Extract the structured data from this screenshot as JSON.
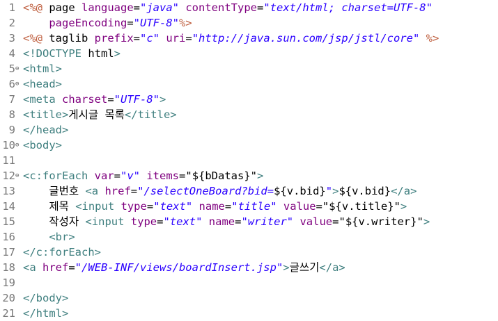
{
  "colors": {
    "directive": "#bf5f3f",
    "attribute": "#7f007f",
    "value": "#2a00ff",
    "tag": "#3f7f7f",
    "text": "#000000",
    "line_number": "#787878"
  },
  "fold_icon": "collapse-minus-icon",
  "lines": [
    {
      "n": "1",
      "fold": false,
      "tokens": [
        [
          "directive",
          "<%@ "
        ],
        [
          "text",
          "page "
        ],
        [
          "attr",
          "language"
        ],
        [
          "text",
          "="
        ],
        [
          "val",
          "\"java\""
        ],
        [
          "text",
          " "
        ],
        [
          "attr",
          "contentType"
        ],
        [
          "text",
          "="
        ],
        [
          "val",
          "\"text/html; charset=UTF-8\""
        ]
      ]
    },
    {
      "n": "2",
      "fold": false,
      "tokens": [
        [
          "text",
          "    "
        ],
        [
          "attr",
          "pageEncoding"
        ],
        [
          "text",
          "="
        ],
        [
          "val",
          "\"UTF-8\""
        ],
        [
          "directive",
          "%>"
        ]
      ]
    },
    {
      "n": "3",
      "fold": false,
      "tokens": [
        [
          "directive",
          "<%@ "
        ],
        [
          "text",
          "taglib "
        ],
        [
          "attr",
          "prefix"
        ],
        [
          "text",
          "="
        ],
        [
          "val",
          "\"c\""
        ],
        [
          "text",
          " "
        ],
        [
          "attr",
          "uri"
        ],
        [
          "text",
          "="
        ],
        [
          "val",
          "\"http://java.sun.com/jsp/jstl/core\""
        ],
        [
          "text",
          " "
        ],
        [
          "directive",
          "%>"
        ]
      ]
    },
    {
      "n": "4",
      "fold": false,
      "tokens": [
        [
          "tag",
          "<!DOCTYPE "
        ],
        [
          "text",
          "html"
        ],
        [
          "tag",
          ">"
        ]
      ]
    },
    {
      "n": "5",
      "fold": true,
      "tokens": [
        [
          "tag",
          "<html>"
        ]
      ]
    },
    {
      "n": "6",
      "fold": true,
      "tokens": [
        [
          "tag",
          "<head>"
        ]
      ]
    },
    {
      "n": "7",
      "fold": false,
      "tokens": [
        [
          "tag",
          "<meta "
        ],
        [
          "attr",
          "charset"
        ],
        [
          "text",
          "="
        ],
        [
          "val",
          "\"UTF-8\""
        ],
        [
          "tag",
          ">"
        ]
      ]
    },
    {
      "n": "8",
      "fold": false,
      "tokens": [
        [
          "tag",
          "<title>"
        ],
        [
          "text",
          "게시글 목록"
        ],
        [
          "tag",
          "</title>"
        ]
      ]
    },
    {
      "n": "9",
      "fold": false,
      "tokens": [
        [
          "tag",
          "</head>"
        ]
      ]
    },
    {
      "n": "10",
      "fold": true,
      "tokens": [
        [
          "tag",
          "<body>"
        ]
      ]
    },
    {
      "n": "11",
      "fold": false,
      "tokens": []
    },
    {
      "n": "12",
      "fold": true,
      "tokens": [
        [
          "tag",
          "<c:forEach "
        ],
        [
          "attr",
          "var"
        ],
        [
          "text",
          "="
        ],
        [
          "val",
          "\"v\""
        ],
        [
          "text",
          " "
        ],
        [
          "attr",
          "items"
        ],
        [
          "text",
          "="
        ],
        [
          "text",
          "\"${bDatas}\""
        ],
        [
          "tag",
          ">"
        ]
      ]
    },
    {
      "n": "13",
      "fold": false,
      "tokens": [
        [
          "text",
          "    글번호 "
        ],
        [
          "tag",
          "<a "
        ],
        [
          "attr",
          "href"
        ],
        [
          "text",
          "="
        ],
        [
          "val",
          "\"/selectOneBoard?bid="
        ],
        [
          "text",
          "${v.bid}"
        ],
        [
          "val",
          "\""
        ],
        [
          "tag",
          ">"
        ],
        [
          "text",
          "${v.bid}"
        ],
        [
          "tag",
          "</a>"
        ]
      ]
    },
    {
      "n": "14",
      "fold": false,
      "tokens": [
        [
          "text",
          "    제목 "
        ],
        [
          "tag",
          "<input "
        ],
        [
          "attr",
          "type"
        ],
        [
          "text",
          "="
        ],
        [
          "val",
          "\"text\""
        ],
        [
          "text",
          " "
        ],
        [
          "attr",
          "name"
        ],
        [
          "text",
          "="
        ],
        [
          "val",
          "\"title\""
        ],
        [
          "text",
          " "
        ],
        [
          "attr",
          "value"
        ],
        [
          "text",
          "="
        ],
        [
          "text",
          "\"${v.title}\""
        ],
        [
          "tag",
          ">"
        ]
      ]
    },
    {
      "n": "15",
      "fold": false,
      "tokens": [
        [
          "text",
          "    작성자 "
        ],
        [
          "tag",
          "<input "
        ],
        [
          "attr",
          "type"
        ],
        [
          "text",
          "="
        ],
        [
          "val",
          "\"text\""
        ],
        [
          "text",
          " "
        ],
        [
          "attr",
          "name"
        ],
        [
          "text",
          "="
        ],
        [
          "val",
          "\"writer\""
        ],
        [
          "text",
          " "
        ],
        [
          "attr",
          "value"
        ],
        [
          "text",
          "="
        ],
        [
          "text",
          "\"${v.writer}\""
        ],
        [
          "tag",
          ">"
        ]
      ]
    },
    {
      "n": "16",
      "fold": false,
      "tokens": [
        [
          "text",
          "    "
        ],
        [
          "tag",
          "<br>"
        ]
      ]
    },
    {
      "n": "17",
      "fold": false,
      "tokens": [
        [
          "tag",
          "</c:forEach>"
        ]
      ]
    },
    {
      "n": "18",
      "fold": false,
      "tokens": [
        [
          "tag",
          "<a "
        ],
        [
          "attr",
          "href"
        ],
        [
          "text",
          "="
        ],
        [
          "val",
          "\"/WEB-INF/views/boardInsert.jsp\""
        ],
        [
          "tag",
          ">"
        ],
        [
          "text",
          "글쓰기"
        ],
        [
          "tag",
          "</a>"
        ]
      ]
    },
    {
      "n": "19",
      "fold": false,
      "tokens": []
    },
    {
      "n": "20",
      "fold": false,
      "tokens": [
        [
          "tag",
          "</body>"
        ]
      ]
    },
    {
      "n": "21",
      "fold": false,
      "tokens": [
        [
          "tag",
          "</html>"
        ]
      ]
    }
  ]
}
